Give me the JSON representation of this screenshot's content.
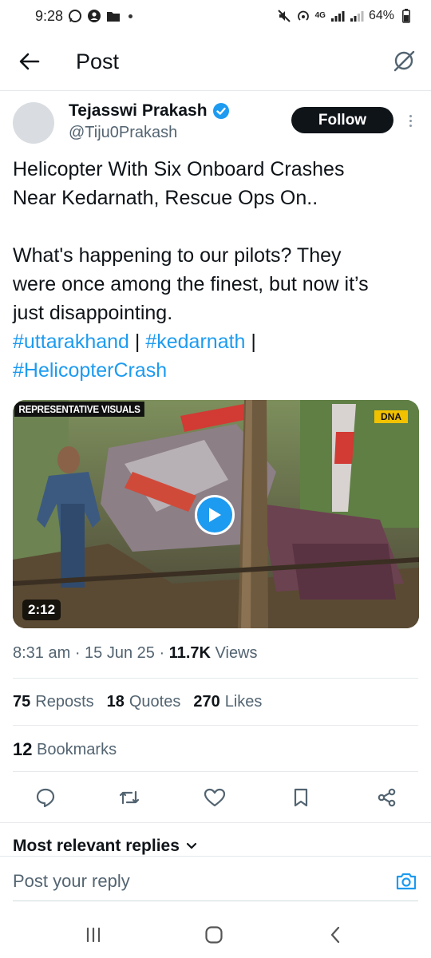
{
  "status_bar": {
    "time": "9:28",
    "battery": "64%",
    "network": "4G"
  },
  "header": {
    "title": "Post"
  },
  "author": {
    "name": "Tejasswi Prakash",
    "handle": "@Tiju0Prakash",
    "follow_label": "Follow"
  },
  "tweet": {
    "line1": "Helicopter With Six Onboard Crashes",
    "line2": "Near Kedarnath, Rescue Ops On..",
    "line3": "What's happening to our pilots? They",
    "line4": "were once among the finest, but now it’s",
    "line5": "just disappointing.",
    "hashtag1": "#uttarakhand",
    "sep1": " | ",
    "hashtag2": "#kedarnath",
    "sep2": " |",
    "hashtag3": "#HelicopterCrash"
  },
  "media": {
    "overlay_label": "REPRESENTATIVE VISUALS",
    "badge": "DNA",
    "duration": "2:12"
  },
  "meta": {
    "time": "8:31 am",
    "date": "15 Jun 25",
    "views_count": "11.7K",
    "views_label": "Views"
  },
  "stats": {
    "reposts_count": "75",
    "reposts_label": "Reposts",
    "quotes_count": "18",
    "quotes_label": "Quotes",
    "likes_count": "270",
    "likes_label": "Likes",
    "bookmarks_count": "12",
    "bookmarks_label": "Bookmarks"
  },
  "replies": {
    "sort_label": "Most relevant replies",
    "placeholder": "Post your reply"
  },
  "colors": {
    "accent": "#1d9bf0",
    "text": "#0f1419",
    "muted": "#536471"
  }
}
